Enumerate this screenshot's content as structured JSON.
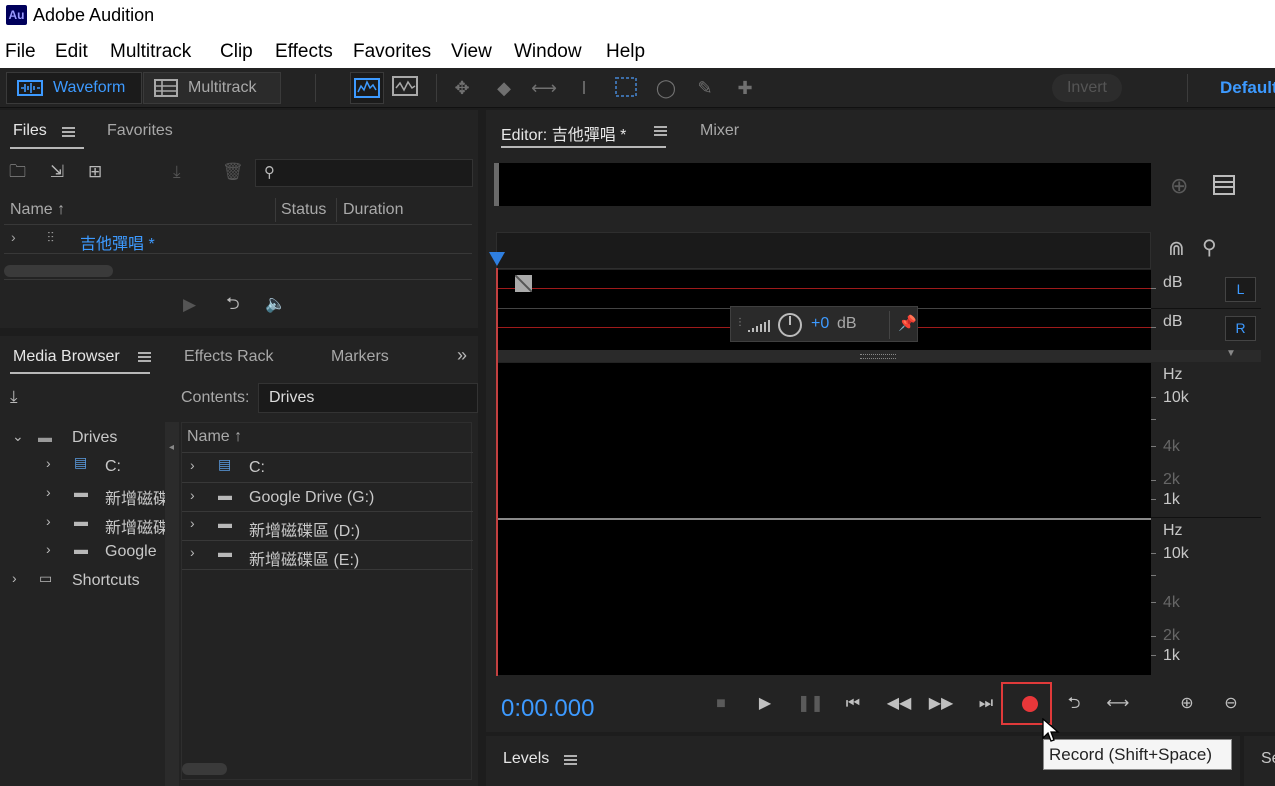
{
  "app": {
    "title": "Adobe Audition",
    "icon_label": "Au"
  },
  "menu": [
    "File",
    "Edit",
    "Multitrack",
    "Clip",
    "Effects",
    "Favorites",
    "View",
    "Window",
    "Help"
  ],
  "toolbar": {
    "waveform_label": "Waveform",
    "multitrack_label": "Multitrack",
    "invert_label": "Invert",
    "workspace_label": "Default"
  },
  "files_panel": {
    "tabs": [
      "Files",
      "Favorites"
    ],
    "columns": {
      "name": "Name",
      "status": "Status",
      "duration": "Duration"
    },
    "rows": [
      {
        "name": "吉他彈唱 *"
      }
    ]
  },
  "media_browser": {
    "tabs": [
      "Media Browser",
      "Effects Rack",
      "Markers"
    ],
    "contents_label": "Contents:",
    "contents_value": "Drives",
    "tree": {
      "root": "Drives",
      "items": [
        "C:",
        "新增磁碟",
        "新增磁碟",
        "Google"
      ],
      "shortcuts": "Shortcuts"
    },
    "list_header": "Name",
    "list": [
      "C:",
      "Google Drive (G:)",
      "新增磁碟區 (D:)",
      "新增磁碟區 (E:)"
    ]
  },
  "editor": {
    "tab_label": "Editor: 吉他彈唱 *",
    "mixer_label": "Mixer",
    "hud": {
      "value": "+0",
      "unit": "dB"
    },
    "scale": {
      "db_top": "dB",
      "db_bottom": "dB",
      "left_badge": "L",
      "right_badge": "R",
      "hz1": "Hz",
      "k10_1": "10k",
      "k4_1": "4k",
      "k2_1": "2k",
      "k1_1": "1k",
      "hz2": "Hz",
      "k10_2": "10k",
      "k4_2": "4k",
      "k2_2": "2k",
      "k1_2": "1k"
    },
    "time": "0:00.000"
  },
  "tooltip": "Record (Shift+Space)",
  "bottom": {
    "levels_label": "Levels",
    "right_stub": "Se"
  },
  "colors": {
    "accent": "#3d9aff",
    "record": "#e8373a",
    "background": "#232323"
  }
}
